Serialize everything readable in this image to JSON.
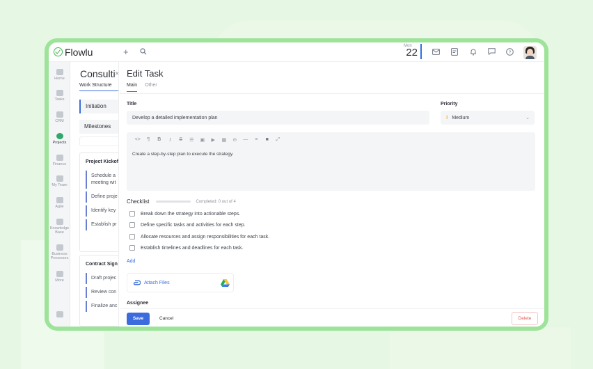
{
  "app": {
    "name": "Flowlu"
  },
  "topbar": {
    "date_month": "Mon",
    "date_day": "22"
  },
  "sidebar": {
    "items": [
      {
        "label": "Home"
      },
      {
        "label": "Tasks"
      },
      {
        "label": "CRM"
      },
      {
        "label": "Projects"
      },
      {
        "label": "Finance"
      },
      {
        "label": "My Team"
      },
      {
        "label": "Agile"
      },
      {
        "label": "Knowledge Base"
      },
      {
        "label": "Business Processes"
      },
      {
        "label": "More"
      }
    ]
  },
  "project": {
    "title": "Consulti",
    "tab": "Work Structure",
    "stage": "Initiation",
    "milestones": "Milestones",
    "cards": [
      {
        "title": "Project Kickof",
        "tasks": [
          "Schedule a meeting wit",
          "Define proje",
          "Identify key",
          "Establish pr"
        ]
      },
      {
        "title": "Contract Sign",
        "tasks": [
          "Draft projec",
          "Review con",
          "Finalize anc"
        ]
      }
    ]
  },
  "task": {
    "heading": "Edit Task",
    "tabs": [
      "Main",
      "Other"
    ],
    "title_label": "Title",
    "title_value": "Develop a detailed implementation plan",
    "priority_label": "Priority",
    "priority_value": "Medium",
    "description": "Create a step-by-step plan to execute the strategy.",
    "checklist_label": "Checklist",
    "checklist_progress": "Completed: 0 out of 4",
    "checklist": [
      "Break down the strategy into actionable steps.",
      "Define specific tasks and activities for each step.",
      "Allocate resources and assign responsibilities for each task.",
      "Establish timelines and deadlines for each task."
    ],
    "add_label": "Add",
    "attach_label": "Attach Files",
    "assignee_label": "Assignee"
  },
  "footer": {
    "save": "Save",
    "cancel": "Cancel",
    "delete": "Delete"
  },
  "colors": {
    "accent": "#3c6bde",
    "brand": "#3fb550",
    "frame": "#9ee39a",
    "danger": "#e25858"
  }
}
